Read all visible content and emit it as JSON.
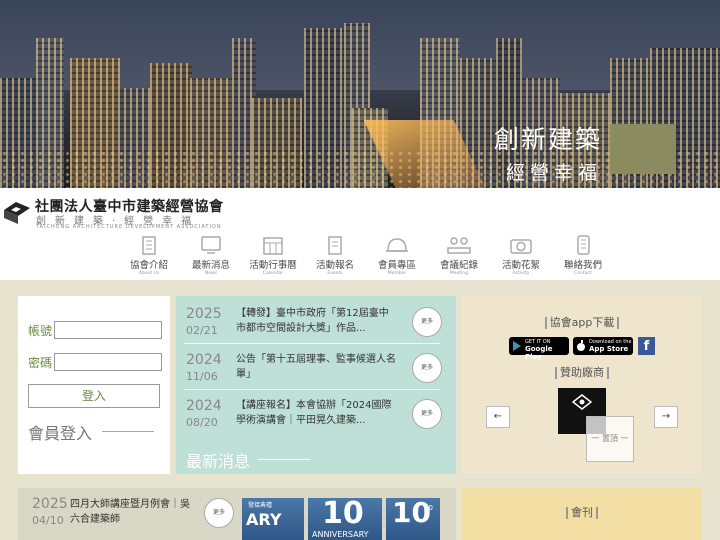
{
  "hero": {
    "slogan_line1": "創新建築",
    "slogan_line2": "經營幸福"
  },
  "header": {
    "org_name": "社團法人臺中市建築經營協會",
    "org_slogan": "創新建築‧經營幸福",
    "org_en": "TAICHUNG ARCHITECTURE DEVELOPMENT ASSOCIATION"
  },
  "nav": [
    {
      "zh": "協會介紹",
      "en": "About Us"
    },
    {
      "zh": "最新消息",
      "en": "News"
    },
    {
      "zh": "活動行事曆",
      "en": "Calendar"
    },
    {
      "zh": "活動報名",
      "en": "Events"
    },
    {
      "zh": "會員專區",
      "en": "Member"
    },
    {
      "zh": "會議紀錄",
      "en": "Meeting"
    },
    {
      "zh": "活動花絮",
      "en": "Activity"
    },
    {
      "zh": "聯絡我們",
      "en": "Contact"
    }
  ],
  "login": {
    "account_label": "帳號",
    "password_label": "密碼",
    "submit_label": "登入",
    "title": "會員登入"
  },
  "news": {
    "title": "最新消息",
    "more_label": "更多",
    "items": [
      {
        "year": "2025",
        "date": "02/21",
        "text": "【轉發】臺中市政府「第12屆臺中市都市空間設計大獎」作品..."
      },
      {
        "year": "2024",
        "date": "11/06",
        "text": "公告「第十五屆理事、監事候選人名單」"
      },
      {
        "year": "2024",
        "date": "08/20",
        "text": "【講座報名】本會協辦「2024國際學術演講會｜平田晃久建築..."
      }
    ]
  },
  "side": {
    "app_heading": "協會app下載",
    "google_small": "GET IT ON",
    "google_big": "Google Play",
    "apple_small": "Download on the",
    "apple_big": "App Store",
    "fb": "f",
    "sponsor_heading": "贊助廠商",
    "prev": "←",
    "next": "→",
    "to_top": "一 置頂 一"
  },
  "bottom": {
    "year": "2025",
    "date": "04/10",
    "text": "四月大師講座暨月例會｜吳六合建築師",
    "more_label": "更多",
    "photo1_small": "發接典禮",
    "photo1_big": "ARY",
    "photo2_big": "10",
    "photo2_small": "ANNIVERSARY",
    "photo3_big": "10",
    "photo3_small": "20",
    "publication_heading": "會刊"
  },
  "colors": {
    "accent_green": "#6a8a3a",
    "news_bg": "#bfe0d6",
    "side_bg": "#efe5cc",
    "hero_box": "#8a8b5f"
  }
}
